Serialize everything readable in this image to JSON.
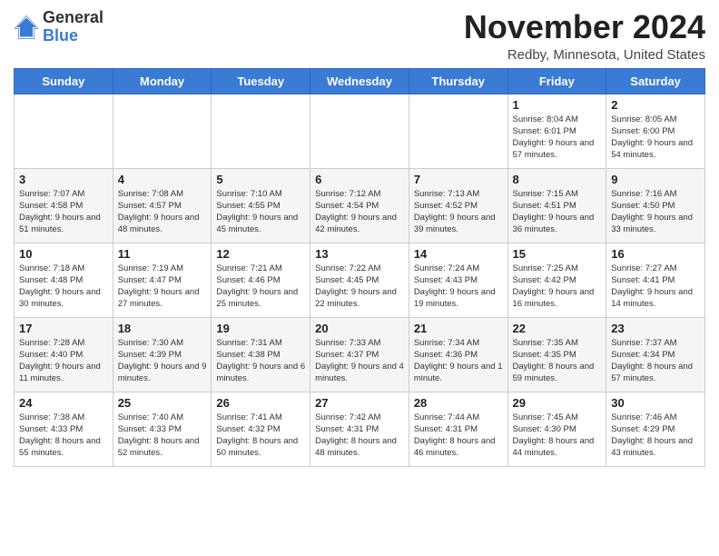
{
  "header": {
    "logo_line1": "General",
    "logo_line2": "Blue",
    "month": "November 2024",
    "location": "Redby, Minnesota, United States"
  },
  "weekdays": [
    "Sunday",
    "Monday",
    "Tuesday",
    "Wednesday",
    "Thursday",
    "Friday",
    "Saturday"
  ],
  "weeks": [
    [
      {
        "day": "",
        "info": ""
      },
      {
        "day": "",
        "info": ""
      },
      {
        "day": "",
        "info": ""
      },
      {
        "day": "",
        "info": ""
      },
      {
        "day": "",
        "info": ""
      },
      {
        "day": "1",
        "info": "Sunrise: 8:04 AM\nSunset: 6:01 PM\nDaylight: 9 hours and 57 minutes."
      },
      {
        "day": "2",
        "info": "Sunrise: 8:05 AM\nSunset: 6:00 PM\nDaylight: 9 hours and 54 minutes."
      }
    ],
    [
      {
        "day": "3",
        "info": "Sunrise: 7:07 AM\nSunset: 4:58 PM\nDaylight: 9 hours and 51 minutes."
      },
      {
        "day": "4",
        "info": "Sunrise: 7:08 AM\nSunset: 4:57 PM\nDaylight: 9 hours and 48 minutes."
      },
      {
        "day": "5",
        "info": "Sunrise: 7:10 AM\nSunset: 4:55 PM\nDaylight: 9 hours and 45 minutes."
      },
      {
        "day": "6",
        "info": "Sunrise: 7:12 AM\nSunset: 4:54 PM\nDaylight: 9 hours and 42 minutes."
      },
      {
        "day": "7",
        "info": "Sunrise: 7:13 AM\nSunset: 4:52 PM\nDaylight: 9 hours and 39 minutes."
      },
      {
        "day": "8",
        "info": "Sunrise: 7:15 AM\nSunset: 4:51 PM\nDaylight: 9 hours and 36 minutes."
      },
      {
        "day": "9",
        "info": "Sunrise: 7:16 AM\nSunset: 4:50 PM\nDaylight: 9 hours and 33 minutes."
      }
    ],
    [
      {
        "day": "10",
        "info": "Sunrise: 7:18 AM\nSunset: 4:48 PM\nDaylight: 9 hours and 30 minutes."
      },
      {
        "day": "11",
        "info": "Sunrise: 7:19 AM\nSunset: 4:47 PM\nDaylight: 9 hours and 27 minutes."
      },
      {
        "day": "12",
        "info": "Sunrise: 7:21 AM\nSunset: 4:46 PM\nDaylight: 9 hours and 25 minutes."
      },
      {
        "day": "13",
        "info": "Sunrise: 7:22 AM\nSunset: 4:45 PM\nDaylight: 9 hours and 22 minutes."
      },
      {
        "day": "14",
        "info": "Sunrise: 7:24 AM\nSunset: 4:43 PM\nDaylight: 9 hours and 19 minutes."
      },
      {
        "day": "15",
        "info": "Sunrise: 7:25 AM\nSunset: 4:42 PM\nDaylight: 9 hours and 16 minutes."
      },
      {
        "day": "16",
        "info": "Sunrise: 7:27 AM\nSunset: 4:41 PM\nDaylight: 9 hours and 14 minutes."
      }
    ],
    [
      {
        "day": "17",
        "info": "Sunrise: 7:28 AM\nSunset: 4:40 PM\nDaylight: 9 hours and 11 minutes."
      },
      {
        "day": "18",
        "info": "Sunrise: 7:30 AM\nSunset: 4:39 PM\nDaylight: 9 hours and 9 minutes."
      },
      {
        "day": "19",
        "info": "Sunrise: 7:31 AM\nSunset: 4:38 PM\nDaylight: 9 hours and 6 minutes."
      },
      {
        "day": "20",
        "info": "Sunrise: 7:33 AM\nSunset: 4:37 PM\nDaylight: 9 hours and 4 minutes."
      },
      {
        "day": "21",
        "info": "Sunrise: 7:34 AM\nSunset: 4:36 PM\nDaylight: 9 hours and 1 minute."
      },
      {
        "day": "22",
        "info": "Sunrise: 7:35 AM\nSunset: 4:35 PM\nDaylight: 8 hours and 59 minutes."
      },
      {
        "day": "23",
        "info": "Sunrise: 7:37 AM\nSunset: 4:34 PM\nDaylight: 8 hours and 57 minutes."
      }
    ],
    [
      {
        "day": "24",
        "info": "Sunrise: 7:38 AM\nSunset: 4:33 PM\nDaylight: 8 hours and 55 minutes."
      },
      {
        "day": "25",
        "info": "Sunrise: 7:40 AM\nSunset: 4:33 PM\nDaylight: 8 hours and 52 minutes."
      },
      {
        "day": "26",
        "info": "Sunrise: 7:41 AM\nSunset: 4:32 PM\nDaylight: 8 hours and 50 minutes."
      },
      {
        "day": "27",
        "info": "Sunrise: 7:42 AM\nSunset: 4:31 PM\nDaylight: 8 hours and 48 minutes."
      },
      {
        "day": "28",
        "info": "Sunrise: 7:44 AM\nSunset: 4:31 PM\nDaylight: 8 hours and 46 minutes."
      },
      {
        "day": "29",
        "info": "Sunrise: 7:45 AM\nSunset: 4:30 PM\nDaylight: 8 hours and 44 minutes."
      },
      {
        "day": "30",
        "info": "Sunrise: 7:46 AM\nSunset: 4:29 PM\nDaylight: 8 hours and 43 minutes."
      }
    ]
  ]
}
